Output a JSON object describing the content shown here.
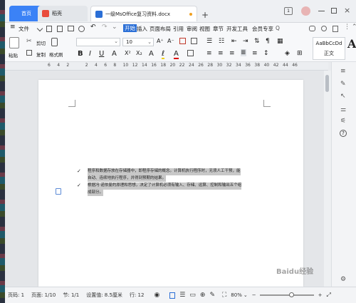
{
  "window": {
    "tabs": [
      {
        "label": "首页",
        "active": false,
        "style": "home"
      },
      {
        "label": "稻壳",
        "active": false,
        "style": "docer"
      },
      {
        "label": "一级MsOffice复习资料.docx",
        "active": true,
        "style": "doc"
      }
    ],
    "new_tab_symbol": "+",
    "window_badge": "1"
  },
  "menu": {
    "file_label": "文件",
    "items": [
      "开始",
      "插入",
      "页面布局",
      "引用",
      "审阅",
      "视图",
      "章节",
      "开发工具",
      "会员专享"
    ],
    "active_item": "开始",
    "search_placeholder": "Q"
  },
  "ribbon": {
    "paste_label": "粘贴",
    "cut_label": "剪切",
    "copy_label": "复制",
    "format_painter_label": "格式刷",
    "font_name_value": "",
    "font_size_value": "10",
    "style_preview": "AaBbCcDd",
    "style_name": "正文",
    "big_a": "A",
    "inc_font": "A⁺",
    "dec_font": "A⁻"
  },
  "ruler": {
    "ticks": [
      "6",
      "4",
      "2",
      "",
      "2",
      "4",
      "6",
      "8",
      "10",
      "12",
      "14",
      "16",
      "18",
      "20",
      "22",
      "24",
      "26",
      "28",
      "30",
      "32",
      "34",
      "36",
      "38",
      "40",
      "42",
      "44",
      "46"
    ]
  },
  "document": {
    "bullet1": "程序和数据存放在存储器中，即程序存储的概念。计算机执行程序时，无须人工干预，能自动、连续地执行程序，并得到预期的结果。",
    "bullet1_lines": [
      "程序和数据存放在存储器中，即程序存储的概念。计算机执行程序时，无须人工干预，能",
      "自动、连续地执行程序，并得到预期的结果。"
    ],
    "bullet2_lines": [
      "根据冯·诺依曼的原理和思想，决定了计算机必须有输入、存储、运算、控制和输出五个组",
      "成部分。"
    ]
  },
  "status": {
    "page_num": "页码: 1",
    "page_count": "页面: 1/10",
    "section": "节: 1/1",
    "setting": "设置值: 8.5厘米",
    "row": "行: 12",
    "zoom": "80%",
    "zoom_minus": "−",
    "zoom_plus": "+",
    "zoom_fraction": 0.6
  },
  "colors": {
    "accent": "#2b6fd6",
    "home_tab": "#3b82f6",
    "docer_tab": "#e94b3c",
    "selection": "#c8c8c8"
  },
  "watermark": "Baidu经验"
}
